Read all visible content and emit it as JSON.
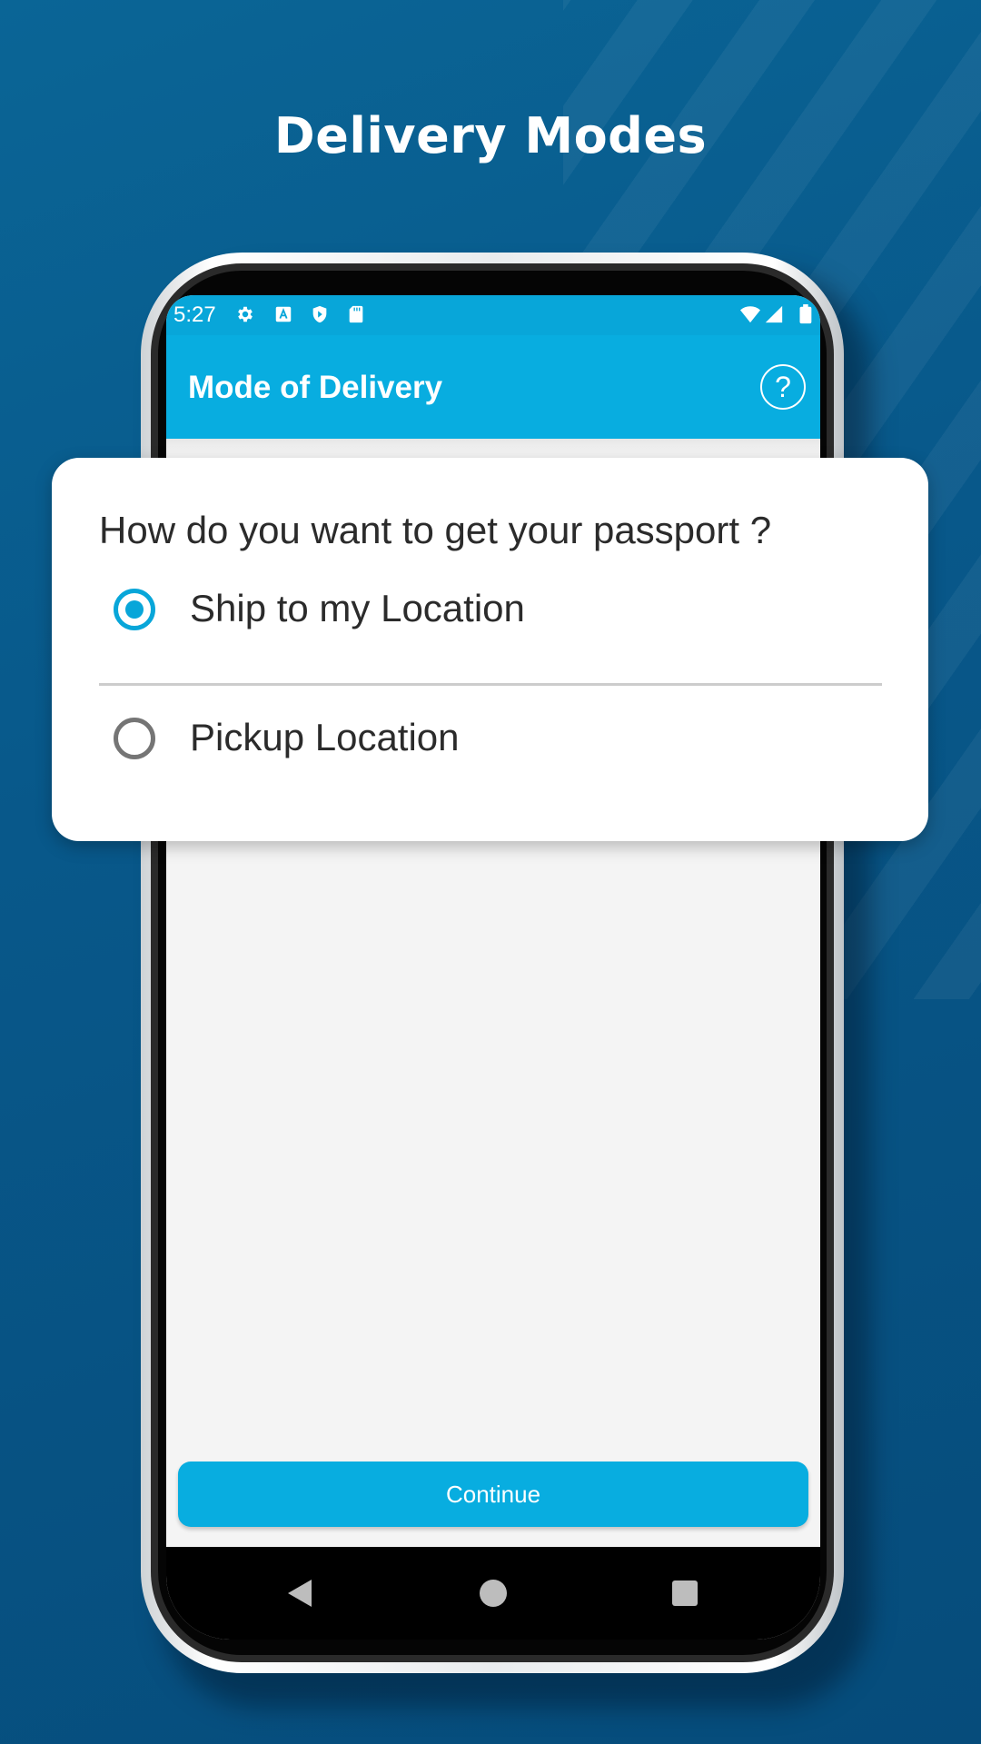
{
  "promo": {
    "headline": "Delivery Modes"
  },
  "status_bar": {
    "time": "5:27",
    "left_icons": [
      "gear-icon",
      "a-box-icon",
      "shield-play-icon",
      "sd-card-icon"
    ],
    "right_icons": [
      "wifi-icon",
      "signal-icon",
      "battery-icon"
    ]
  },
  "app_bar": {
    "title": "Mode of Delivery",
    "help_label": "?"
  },
  "dialog": {
    "question": "How do you want to get your passport ?",
    "options": [
      {
        "label": "Ship to my Location",
        "selected": true
      },
      {
        "label": "Pickup Location",
        "selected": false
      }
    ]
  },
  "actions": {
    "continue_label": "Continue"
  },
  "nav_bar": {
    "buttons": [
      "back-icon",
      "home-icon",
      "recents-icon"
    ]
  },
  "colors": {
    "accent": "#08ade0",
    "background": "#08588a",
    "radio_checked": "#08a6d9",
    "radio_unchecked": "#757575"
  }
}
